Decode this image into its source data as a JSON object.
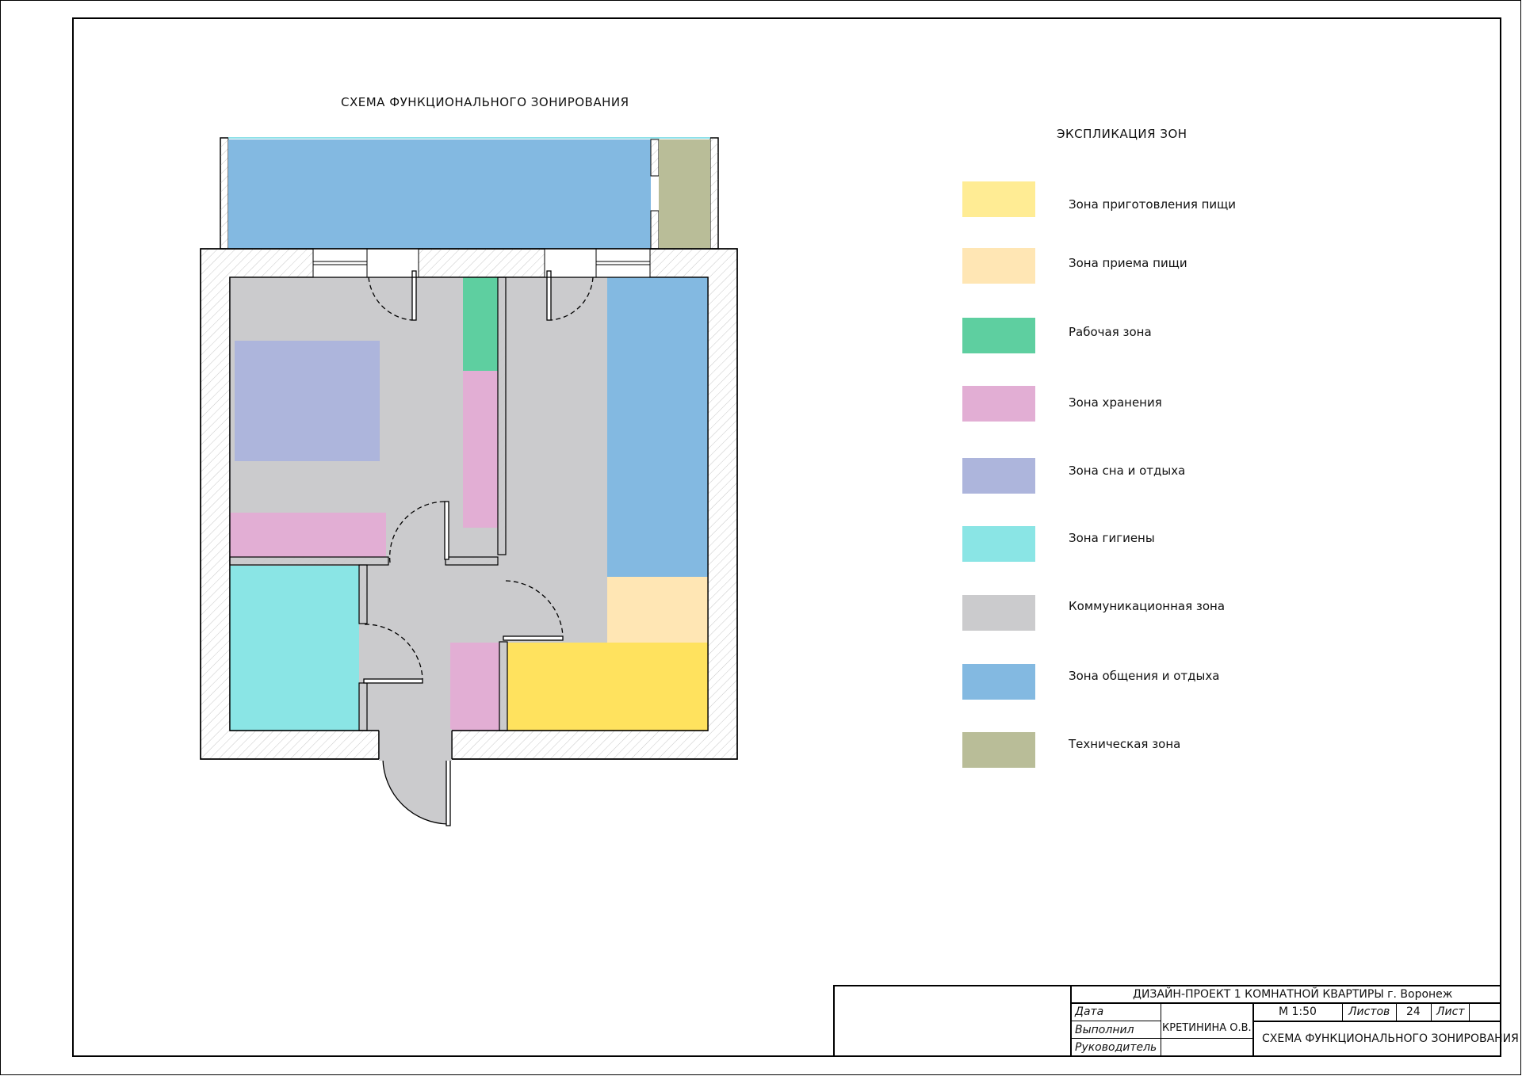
{
  "plan": {
    "title": "СХЕМА ФУНКЦИОНАЛЬНОГО ЗОНИРОВАНИЯ"
  },
  "legend": {
    "title": "ЭКСПЛИКАЦИЯ ЗОН",
    "items": [
      {
        "label": "Зона приготовления пищи",
        "color": "#FFEC94"
      },
      {
        "label": "Зона приема пищи",
        "color": "#FFE6B4"
      },
      {
        "label": "Рабочая зона",
        "color": "#5ECFA0"
      },
      {
        "label": "Зона хранения",
        "color": "#E2AED4"
      },
      {
        "label": "Зона сна и отдыха",
        "color": "#ADB5DC"
      },
      {
        "label": "Зона гигиены",
        "color": "#8AE5E5"
      },
      {
        "label": "Коммуникационная зона",
        "color": "#CBCBCD"
      },
      {
        "label": "Зона общения и отдыха",
        "color": "#83B9E1"
      },
      {
        "label": "Техническая зона",
        "color": "#B9BD98"
      }
    ]
  },
  "zone_colors": {
    "cooking_bright": "#FFE25E",
    "wall": "#FFFFFF",
    "outline": "#000000"
  },
  "title_block": {
    "project": "ДИЗАЙН-ПРОЕКТ 1 КОМНАТНОЙ КВАРТИРЫ г. Воронеж",
    "date_label": "Дата",
    "performed_label": "Выполнил",
    "performer": "КРЕТИНИНА О.В.",
    "supervisor_label": "Руководитель",
    "scale": "М 1:50",
    "sheets_label": "Листов",
    "sheets": "24",
    "sheet_label": "Лист",
    "sheet_title": "СХЕМА ФУНКЦИОНАЛЬНОГО ЗОНИРОВАНИЯ"
  }
}
